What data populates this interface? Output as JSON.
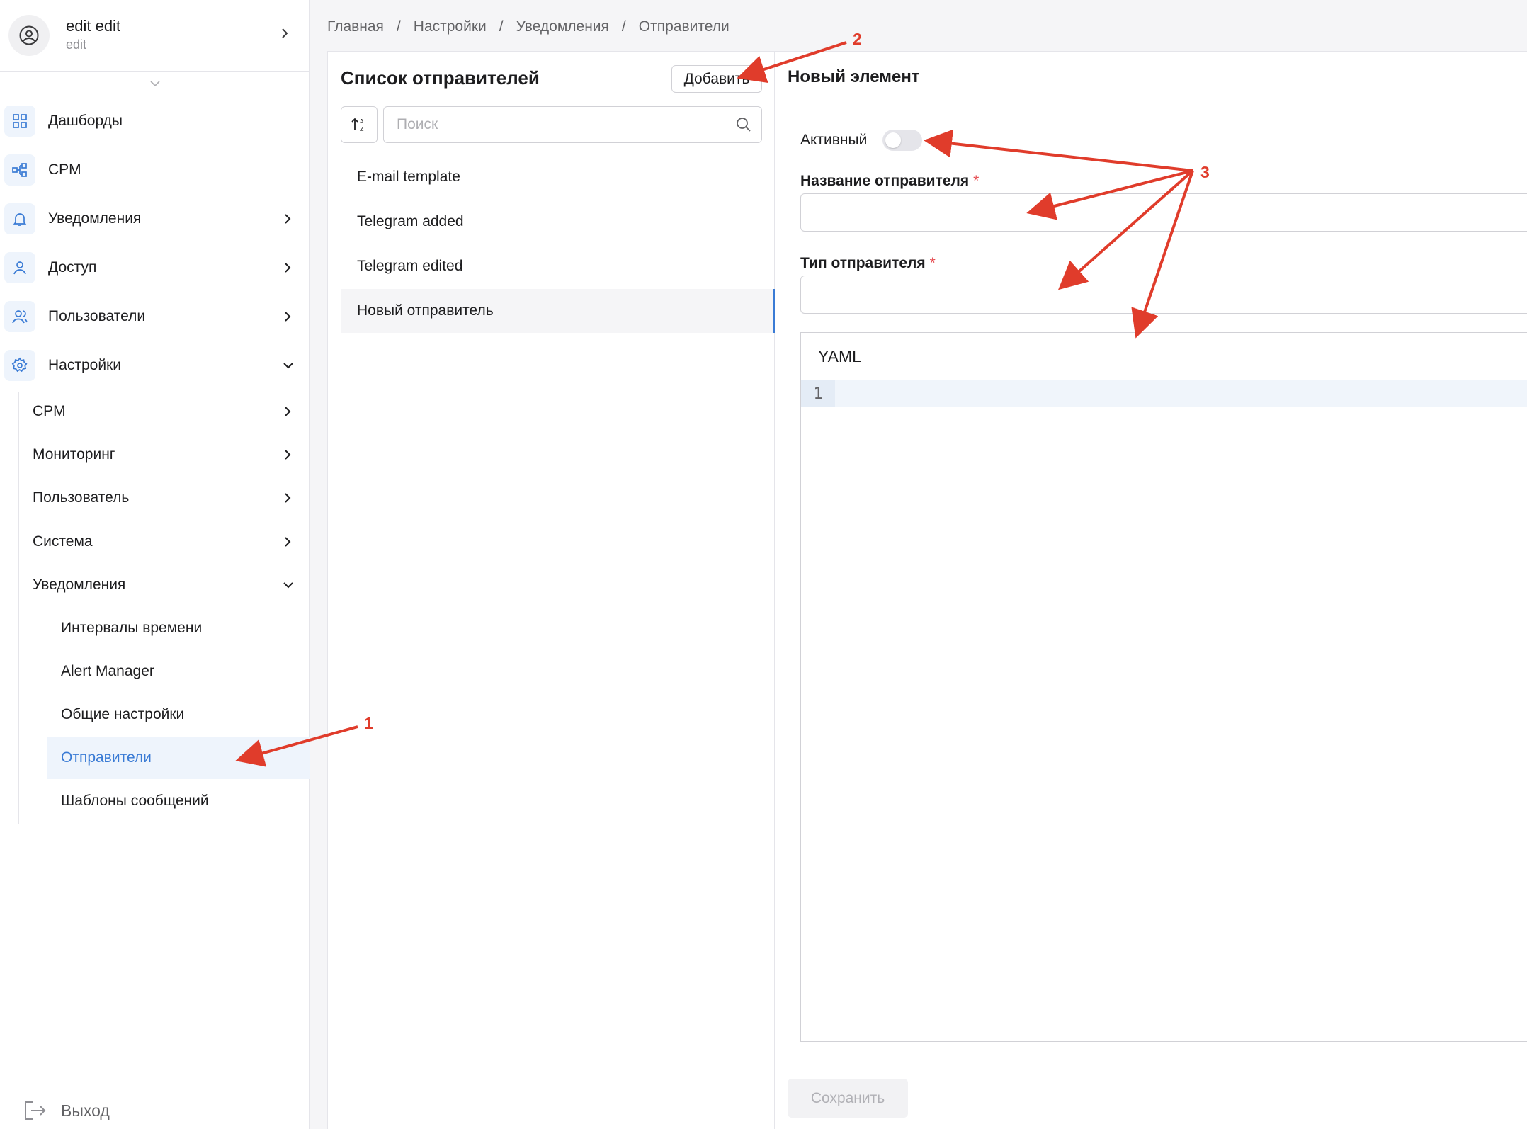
{
  "user": {
    "name": "edit edit",
    "role": "edit"
  },
  "sidebar": {
    "items": [
      {
        "label": "Дашборды",
        "icon": "dashboard-icon",
        "chevron": ""
      },
      {
        "label": "CPM",
        "icon": "network-icon",
        "chevron": ""
      },
      {
        "label": "Уведомления",
        "icon": "bell-icon",
        "chevron": "right"
      },
      {
        "label": "Доступ",
        "icon": "user-icon",
        "chevron": "right"
      },
      {
        "label": "Пользователи",
        "icon": "users-icon",
        "chevron": "right"
      },
      {
        "label": "Настройки",
        "icon": "gear-icon",
        "chevron": "down"
      }
    ],
    "settings_children": [
      {
        "label": "CPM",
        "chevron": "right"
      },
      {
        "label": "Мониторинг",
        "chevron": "right"
      },
      {
        "label": "Пользователь",
        "chevron": "right"
      },
      {
        "label": "Система",
        "chevron": "right"
      },
      {
        "label": "Уведомления",
        "chevron": "down"
      }
    ],
    "notification_children": [
      {
        "label": "Интервалы времени",
        "active": false
      },
      {
        "label": "Alert Manager",
        "active": false
      },
      {
        "label": "Общие настройки",
        "active": false
      },
      {
        "label": "Отправители",
        "active": true
      },
      {
        "label": "Шаблоны сообщений",
        "active": false
      }
    ],
    "logout_label": "Выход"
  },
  "breadcrumb": [
    "Главная",
    "Настройки",
    "Уведомления",
    "Отправители"
  ],
  "list_panel": {
    "title": "Список отправителей",
    "add_label": "Добавить",
    "search_placeholder": "Поиск",
    "items": [
      {
        "label": "E-mail template",
        "active": false
      },
      {
        "label": "Telegram added",
        "active": false
      },
      {
        "label": "Telegram edited",
        "active": false
      },
      {
        "label": "Новый отправитель",
        "active": true
      }
    ]
  },
  "form": {
    "title": "Новый элемент",
    "active_label": "Активный",
    "active_value": false,
    "name_label": "Название отправителя",
    "type_label": "Тип отправителя",
    "required_mark": "*",
    "editor_title": "YAML",
    "editor_line_number": "1",
    "save_label": "Сохранить"
  },
  "annotations": [
    "1",
    "2",
    "3"
  ],
  "colors": {
    "accent": "#3a7bd5",
    "annotation": "#e03c2b",
    "required": "#e5484d"
  }
}
